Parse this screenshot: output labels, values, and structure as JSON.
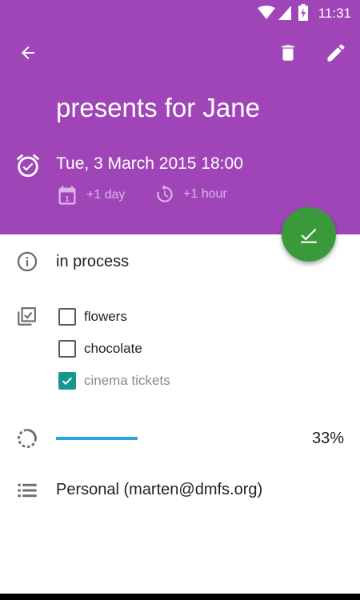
{
  "status_bar": {
    "time": "11:31"
  },
  "task": {
    "title": "presents for Jane",
    "due": "Tue, 3 March 2015 18:00",
    "postpone_day": "+1 day",
    "postpone_hour": "+1 hour",
    "status": "in process",
    "checklist": [
      {
        "label": "flowers",
        "checked": false
      },
      {
        "label": "chocolate",
        "checked": false
      },
      {
        "label": "cinema tickets",
        "checked": true
      }
    ],
    "progress_label": "33%",
    "progress_value": 0.33,
    "list": "Personal (marten@dmfs.org)"
  },
  "colors": {
    "header": "#a045b8",
    "fab": "#3a9a3a",
    "progress": "#2ba8dc",
    "checkbox_checked": "#16998c"
  },
  "icons": {
    "back": "arrow-left-icon",
    "delete": "trash-icon",
    "edit": "pencil-icon",
    "alarm": "alarm-icon",
    "calendar": "calendar-icon",
    "snooze": "clock-icon",
    "complete": "check-icon",
    "status": "info-icon",
    "checklist": "checklist-icon",
    "progress": "progress-icon",
    "list": "list-icon"
  }
}
